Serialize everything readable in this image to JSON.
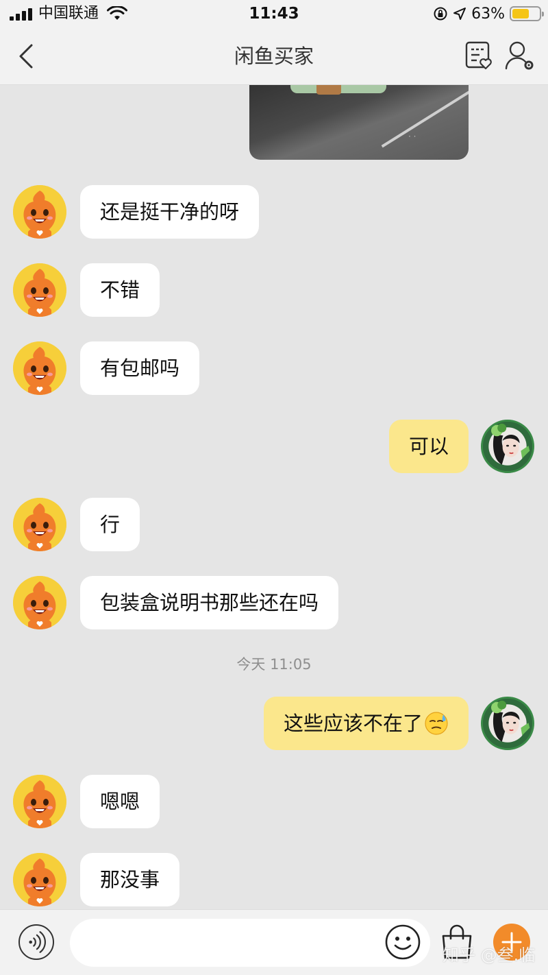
{
  "status_bar": {
    "carrier": "中国联通",
    "time": "11:43",
    "battery_percent": "63%",
    "battery_level": 0.63,
    "icons": [
      "signal-icon",
      "wifi-icon",
      "orientation-lock-icon",
      "location-icon",
      "battery-icon"
    ]
  },
  "nav": {
    "title": "闲鱼买家",
    "back_icon": "chevron-left-icon",
    "note_icon": "note-heart-icon",
    "user_icon": "user-settings-icon"
  },
  "messages": [
    {
      "side": "left",
      "text": "还是挺干净的呀"
    },
    {
      "side": "left",
      "text": "不错"
    },
    {
      "side": "left",
      "text": "有包邮吗"
    },
    {
      "side": "right",
      "text": "可以"
    },
    {
      "side": "left",
      "text": "行"
    },
    {
      "side": "left",
      "text": "包装盒说明书那些还在吗"
    },
    {
      "side": "right",
      "text": "这些应该不在了",
      "emoji": "sweat-face-emoji"
    },
    {
      "side": "left",
      "text": "嗯嗯"
    },
    {
      "side": "left",
      "text": "那没事"
    }
  ],
  "time_divider": "今天 11:05",
  "input_bar": {
    "placeholder": "",
    "voice_icon": "voice-icon",
    "emoji_icon": "smiley-icon",
    "bag_icon": "shopping-bag-icon",
    "plus_icon": "plus-icon"
  },
  "watermark": "知乎 @叁.临",
  "colors": {
    "background": "#e5e5e5",
    "bar_background": "#f2f2f2",
    "sent_bubble": "#fbe78c",
    "received_bubble": "#ffffff",
    "accent": "#f28b2a",
    "battery": "#f5c518"
  }
}
